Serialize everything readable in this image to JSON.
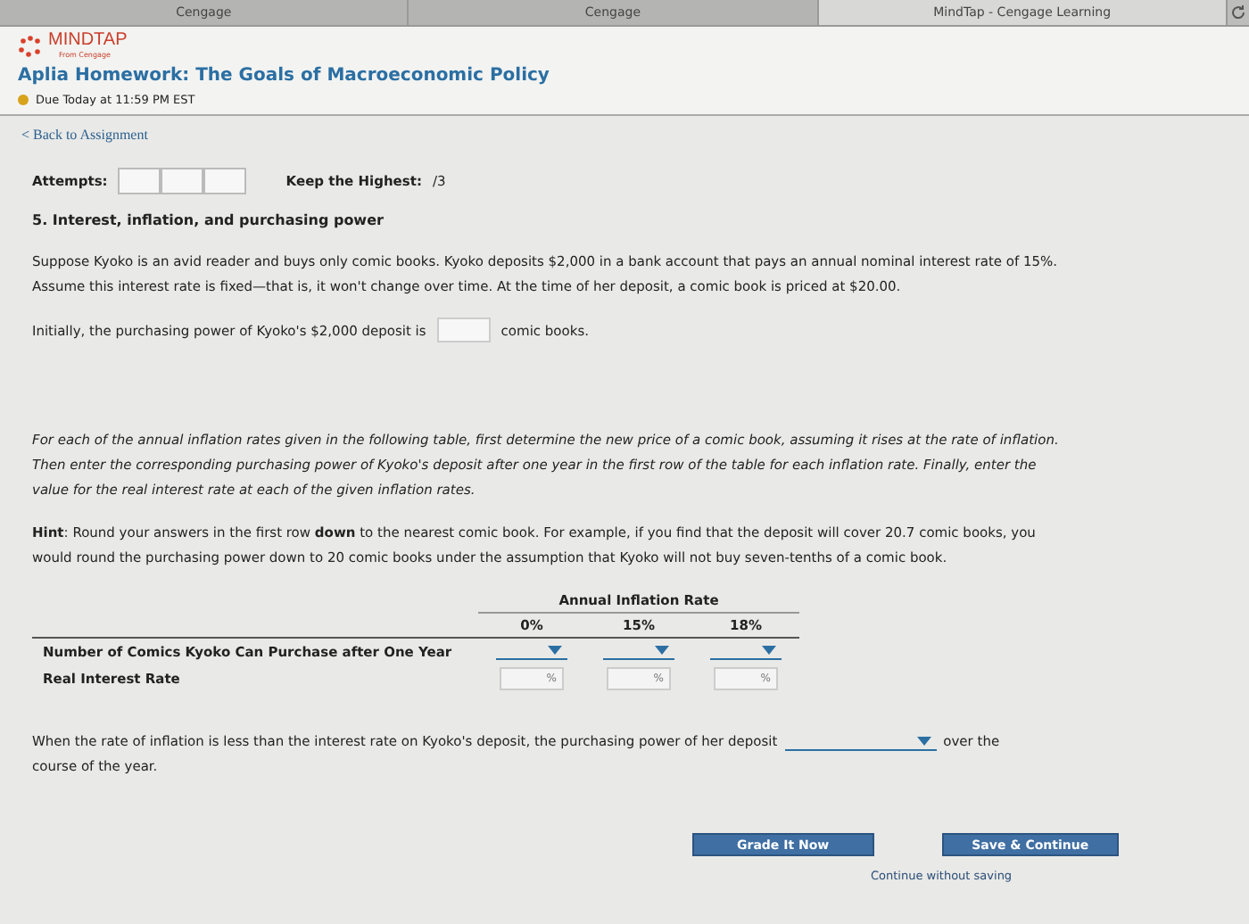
{
  "browser_tabs": [
    {
      "label": "Cengage",
      "selected": false
    },
    {
      "label": "Cengage",
      "selected": false
    },
    {
      "label": "MindTap - Cengage Learning",
      "selected": true
    }
  ],
  "brand": {
    "name": "MINDTAP",
    "tagline": "From Cengage"
  },
  "assignment": {
    "title": "Aplia Homework: The Goals of Macroeconomic Policy",
    "due": "Due Today at 11:59 PM EST",
    "back_link": "< Back to Assignment"
  },
  "attempts": {
    "label": "Attempts:",
    "keep_label": "Keep the Highest:",
    "keep_value": "/3"
  },
  "question": {
    "title": "5. Interest, inflation, and purchasing power",
    "intro": "Suppose Kyoko is an avid reader and buys only comic books. Kyoko deposits $2,000 in a bank account that pays an annual nominal interest rate of 15%. Assume this interest rate is fixed—that is, it won't change over time. At the time of her deposit, a comic book is priced at $20.00.",
    "initial_before": "Initially, the purchasing power of Kyoko's $2,000 deposit is",
    "initial_after": "comic books.",
    "instructions": "For each of the annual inflation rates given in the following table, first determine the new price of a comic book, assuming it rises at the rate of inflation. Then enter the corresponding purchasing power of Kyoko's deposit after one year in the first row of the table for each inflation rate. Finally, enter the value for the real interest rate at each of the given inflation rates.",
    "hint": "**Hint**: Round your answers in the first row **down** to the nearest comic book. For example, if you find that the deposit will cover 20.7 comic books, you would round the purchasing power down to 20 comic books under the assumption that Kyoko will not buy seven-tenths of a comic book."
  },
  "table": {
    "group_heading": "Annual Inflation Rate",
    "columns": [
      "0%",
      "15%",
      "18%"
    ],
    "rows": [
      {
        "label": "Number of Comics Kyoko Can Purchase after One Year",
        "kind": "dropdown",
        "unit": ""
      },
      {
        "label": "Real Interest Rate",
        "kind": "percent",
        "unit": "%"
      }
    ]
  },
  "conclusion": {
    "before": "When the rate of inflation is less than the interest rate on Kyoko's deposit, the purchasing power of her deposit",
    "after": "over the",
    "continued": "course of the year."
  },
  "buttons": [
    "Grade It Now",
    "Save & Continue"
  ],
  "skip_link": "Continue without saving"
}
